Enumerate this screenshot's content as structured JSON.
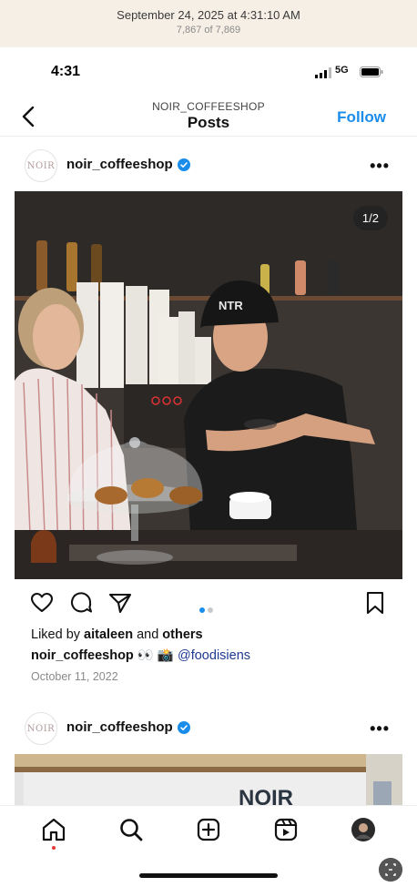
{
  "photos_app": {
    "date": "September 24, 2025 at 4:31:10 AM",
    "count": "7,867 of 7,869"
  },
  "status_bar": {
    "time": "4:31",
    "network": "5G"
  },
  "nav": {
    "account": "NOIR_COFFEESHOP",
    "title": "Posts",
    "follow_label": "Follow"
  },
  "post1": {
    "avatar_text": "NOIR",
    "username": "noir_coffeeshop",
    "more": "•••",
    "image_counter": "1/2",
    "cap_text": "NTR",
    "likes_prefix": "Liked by ",
    "likes_user": "aitaleen",
    "likes_and": " and ",
    "likes_others": "others",
    "caption_user": "noir_coffeeshop",
    "caption_emoji": " 👀 📸 ",
    "caption_mention": "@foodisiens",
    "date": "October 11, 2022"
  },
  "post2": {
    "avatar_text": "NOIR",
    "username": "noir_coffeeshop",
    "more": "•••",
    "sign_text": "NOIR"
  },
  "colors": {
    "accent": "#1a8cea",
    "verified": "#1a8cea",
    "notification": "#e53935"
  },
  "icons": {
    "actions": [
      "heart-icon",
      "comment-icon",
      "share-icon",
      "bookmark-icon"
    ],
    "tabs": [
      "home-icon",
      "search-icon",
      "create-icon",
      "reels-icon",
      "profile-avatar"
    ]
  }
}
